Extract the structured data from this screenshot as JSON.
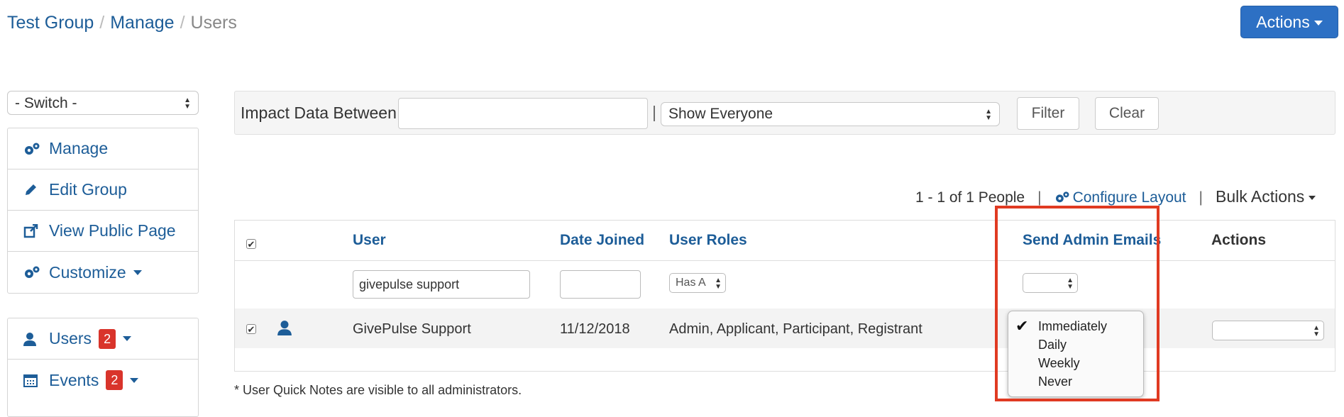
{
  "breadcrumb": {
    "items": [
      "Test Group",
      "Manage",
      "Users"
    ],
    "separator": "/"
  },
  "header": {
    "actions_label": "Actions"
  },
  "sidebar": {
    "switch_label": "- Switch -",
    "group1": [
      {
        "label": "Manage",
        "icon": "gears-icon"
      },
      {
        "label": "Edit Group",
        "icon": "pencil-icon"
      },
      {
        "label": "View Public Page",
        "icon": "external-link-icon"
      },
      {
        "label": "Customize",
        "icon": "gears-icon",
        "has_caret": true
      }
    ],
    "group2": [
      {
        "label": "Users",
        "icon": "user-icon",
        "badge": "2"
      },
      {
        "label": "Events",
        "icon": "calendar-icon",
        "badge": "2"
      }
    ]
  },
  "filter": {
    "impact_label": "Impact Data Between",
    "impact_value": "",
    "pipe": "|",
    "show_select": "Show Everyone",
    "filter_button": "Filter",
    "clear_button": "Clear"
  },
  "paging": {
    "count_text": "1 - 1 of 1 People",
    "configure_label": "Configure Layout",
    "bulk_label": "Bulk Actions"
  },
  "table": {
    "headers": {
      "user": "User",
      "date_joined": "Date Joined",
      "user_roles": "User Roles",
      "send_admin_emails": "Send Admin Emails",
      "actions": "Actions"
    },
    "filters": {
      "user": "givepulse support",
      "date_joined": "",
      "roles": "Has A",
      "send_admin_emails": ""
    },
    "rows": [
      {
        "user": "GivePulse Support",
        "date_joined": "11/12/2018",
        "roles": "Admin, Applicant, Participant, Registrant",
        "actions": ""
      }
    ]
  },
  "send_admin_emails_dropdown": {
    "selected": "Immediately",
    "options": [
      "Immediately",
      "Daily",
      "Weekly",
      "Never"
    ]
  },
  "notes": {
    "line1": "* User Quick Notes are visible to all administrators."
  },
  "colors": {
    "link": "#1d5d98",
    "primary_button": "#2d70c4",
    "badge": "#d9342b",
    "highlight": "#e03a22"
  }
}
